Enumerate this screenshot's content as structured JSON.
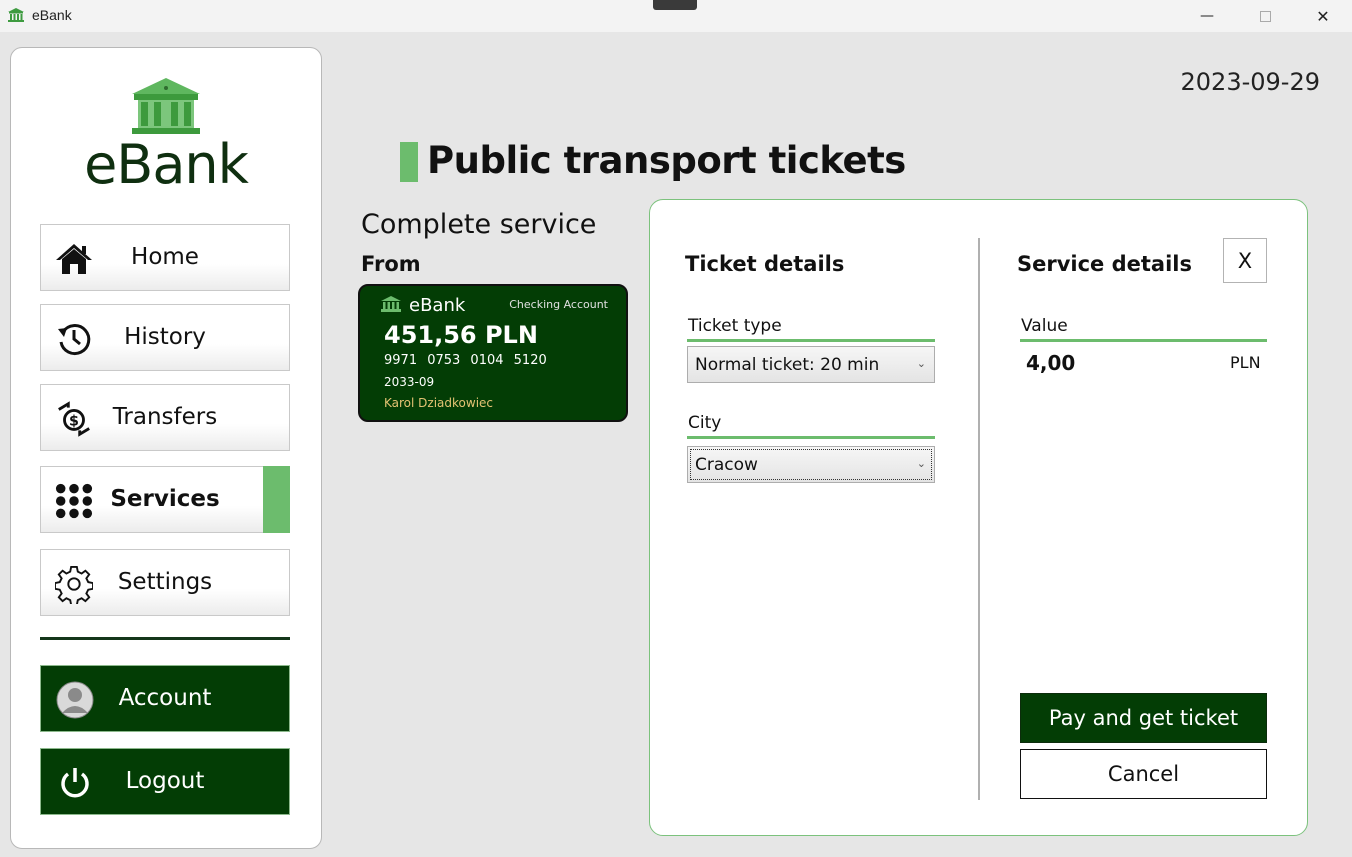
{
  "window": {
    "title": "eBank"
  },
  "brand": {
    "name": "eBank"
  },
  "sidebar": {
    "items": [
      {
        "label": "Home",
        "icon": "home-icon"
      },
      {
        "label": "History",
        "icon": "history-icon"
      },
      {
        "label": "Transfers",
        "icon": "transfers-icon"
      },
      {
        "label": "Services",
        "icon": "grid-icon",
        "active": true
      },
      {
        "label": "Settings",
        "icon": "gear-icon"
      }
    ],
    "account_label": "Account",
    "logout_label": "Logout"
  },
  "header": {
    "date": "2023-09-29",
    "title": "Public transport tickets"
  },
  "main": {
    "subtitle": "Complete service",
    "from_label": "From",
    "card": {
      "brand": "eBank",
      "type": "Checking Account",
      "balance": "451,56 PLN",
      "number": "9971 0753 0104 5120",
      "expiry": "2033-09",
      "holder": "Karol Dziadkowiec"
    }
  },
  "panel": {
    "ticket_details_title": "Ticket details",
    "ticket_type_label": "Ticket type",
    "ticket_type_value": "Normal ticket: 20 min",
    "city_label": "City",
    "city_value": "Cracow",
    "service_details_title": "Service details",
    "close_label": "X",
    "value_label": "Value",
    "value_amount": "4,00",
    "value_currency": "PLN",
    "pay_label": "Pay and get ticket",
    "cancel_label": "Cancel"
  },
  "colors": {
    "accent": "#6cbc6d",
    "dark_green": "#033d05",
    "card_holder": "#e3c373"
  }
}
